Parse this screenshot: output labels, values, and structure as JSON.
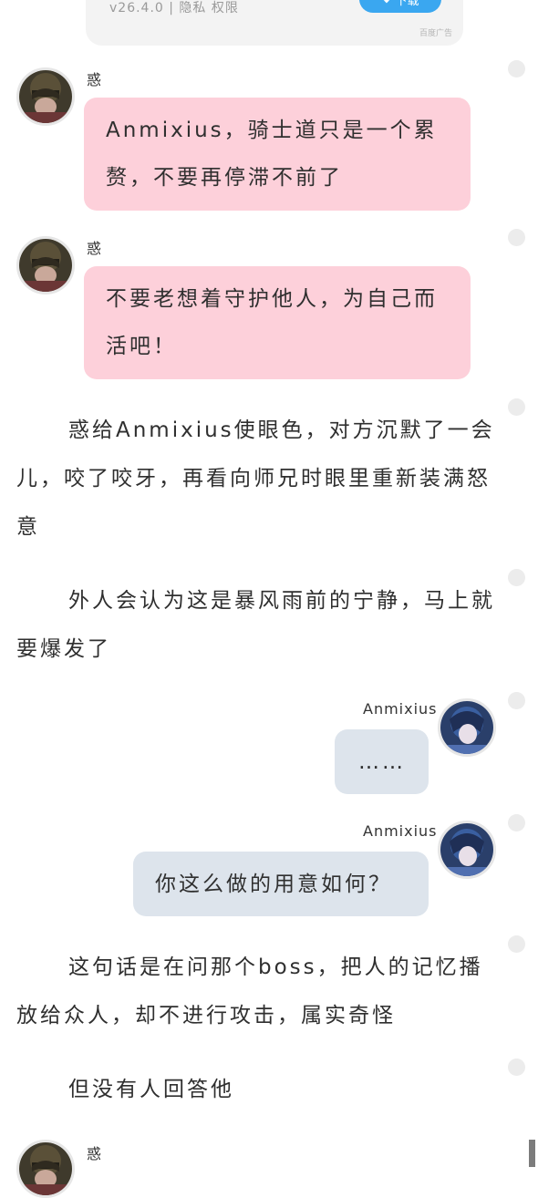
{
  "ad": {
    "meta": "v26.4.0 | 隐私 权限",
    "button_label": "下载",
    "tag": "百度广告"
  },
  "messages": [
    {
      "type": "left",
      "speaker": "惑",
      "text": "Anmixius，骑士道只是一个累赘，不要再停滞不前了"
    },
    {
      "type": "left",
      "speaker": "惑",
      "text": "不要老想着守护他人，为自己而活吧！"
    },
    {
      "type": "narration",
      "text": "惑给Anmixius使眼色，对方沉默了一会儿，咬了咬牙，再看向师兄时眼里重新装满怒意"
    },
    {
      "type": "narration",
      "text": "外人会认为这是暴风雨前的宁静，马上就要爆发了"
    },
    {
      "type": "right",
      "speaker": "Anmixius",
      "text": "……"
    },
    {
      "type": "right",
      "speaker": "Anmixius",
      "text": "你这么做的用意如何？"
    },
    {
      "type": "narration",
      "text": "这句话是在问那个boss，把人的记忆播放给众人，却不进行攻击，属实奇怪"
    },
    {
      "type": "narration",
      "text": "但没有人回答他"
    },
    {
      "type": "left",
      "speaker": "惑",
      "text": ""
    }
  ],
  "colors": {
    "left_bubble": "#fdd0da",
    "right_bubble": "#dde4ec",
    "ad_button": "#3aa7f0"
  }
}
